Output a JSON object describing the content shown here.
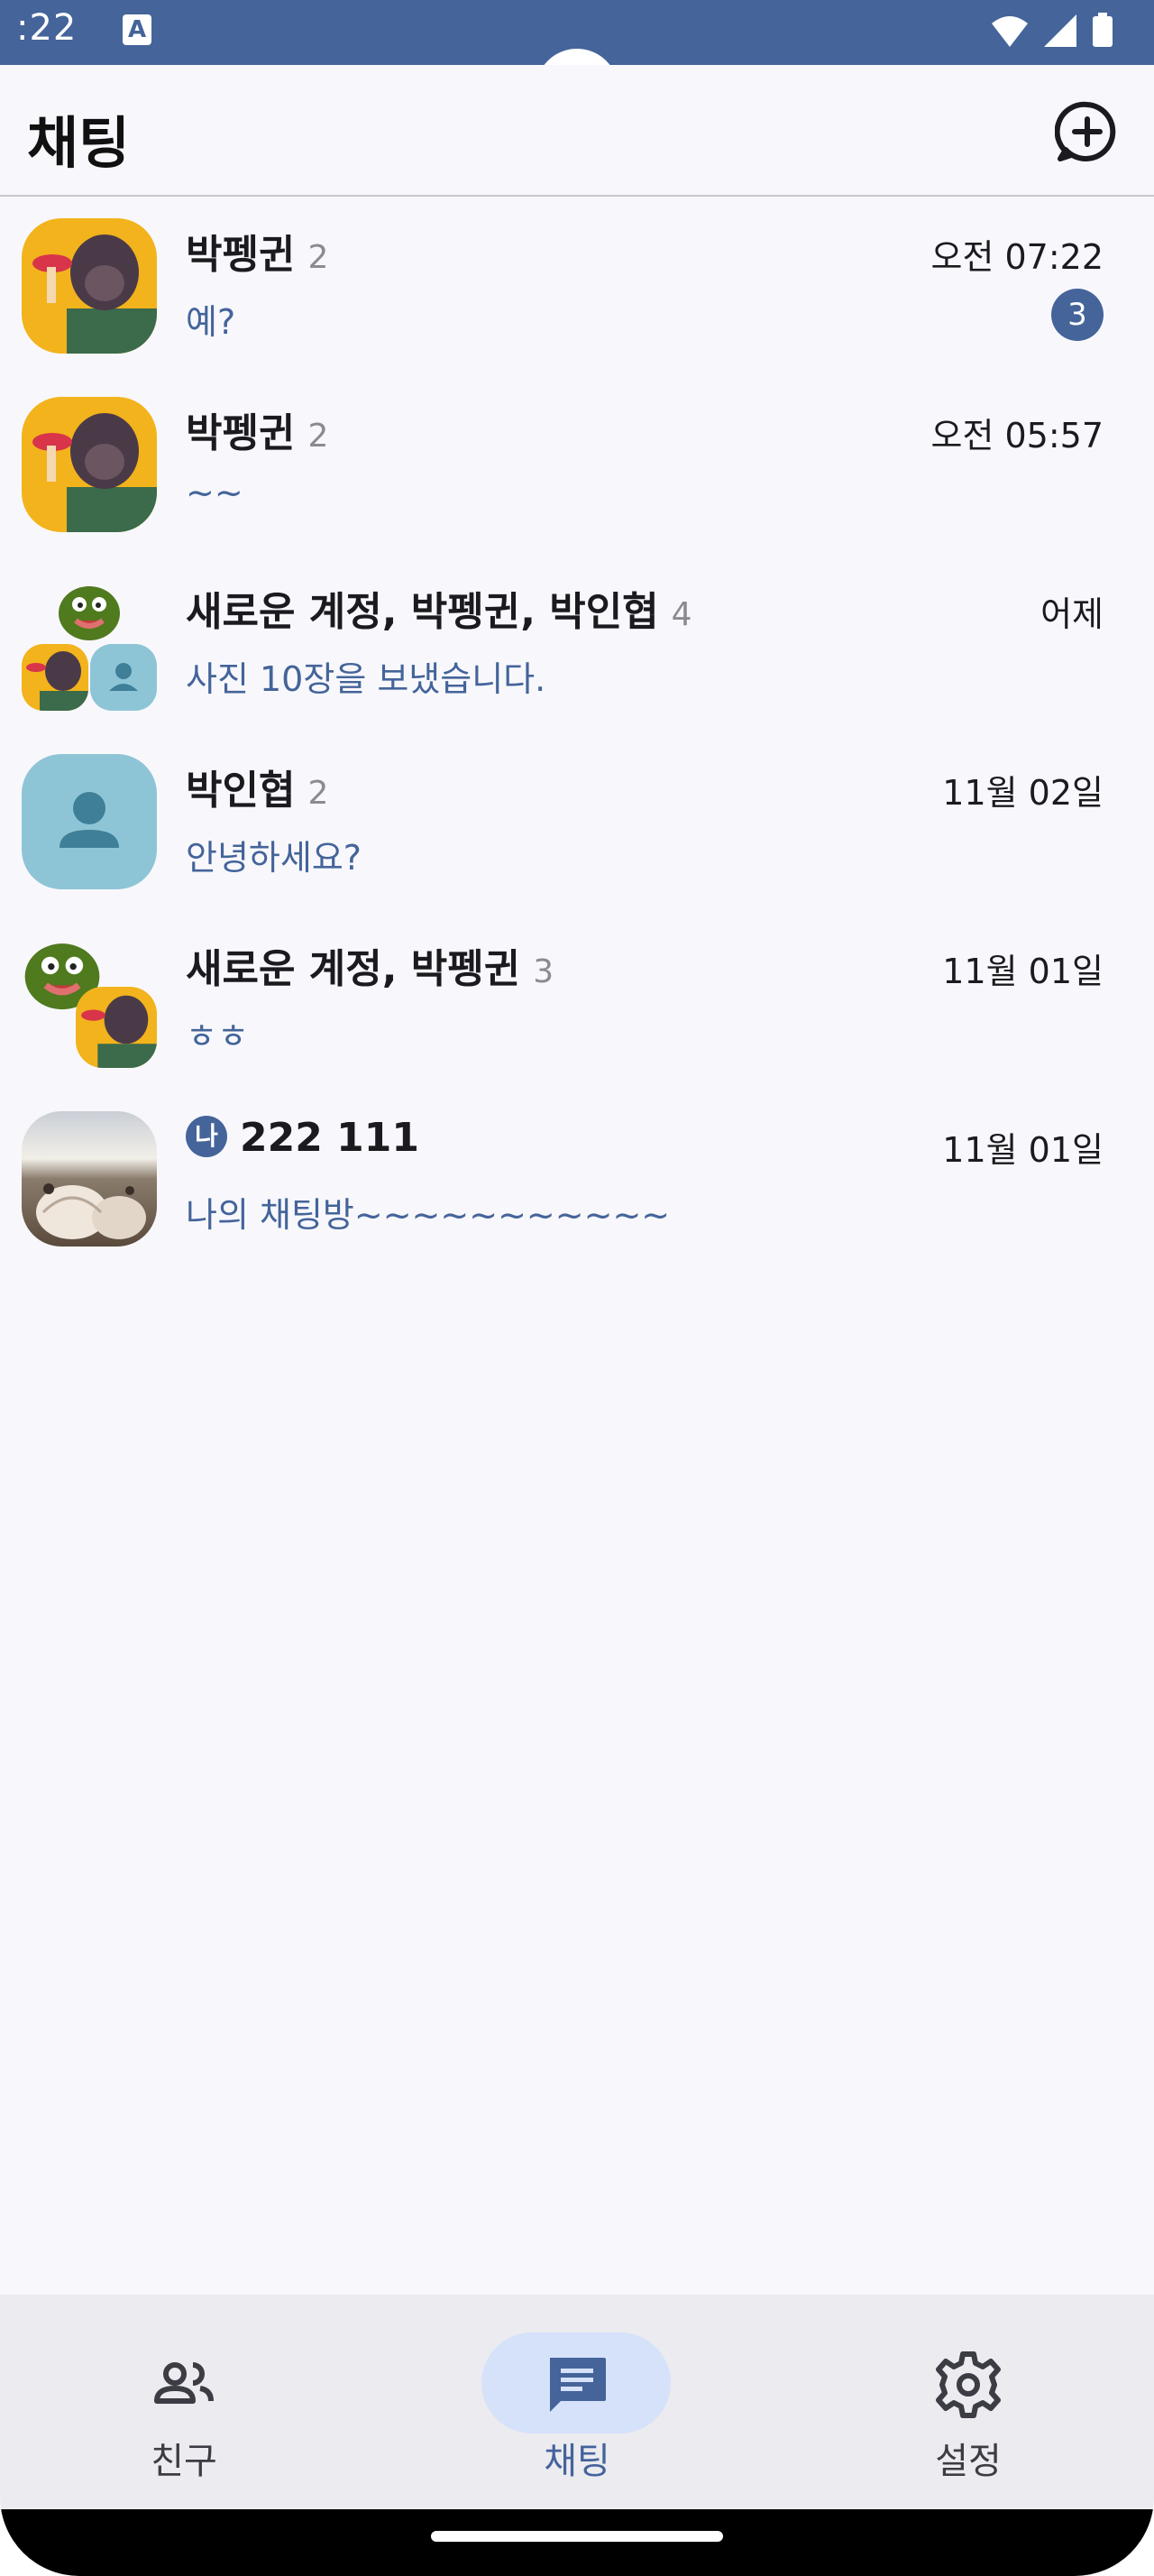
{
  "status_bar": {
    "time": ":22",
    "a_badge": "A"
  },
  "header": {
    "title": "채팅"
  },
  "chats": [
    {
      "name": "박펭귄",
      "count": "2",
      "time": "오전 07:22",
      "preview": "예?",
      "unread": "3"
    },
    {
      "name": "박펭귄",
      "count": "2",
      "time": "오전 05:57",
      "preview": "~~"
    },
    {
      "name": "새로운 계정, 박펭귄, 박인협",
      "count": "4",
      "time": "어제",
      "preview": "사진 10장을 보냈습니다."
    },
    {
      "name": "박인협",
      "count": "2",
      "time": "11월 02일",
      "preview": "안녕하세요?"
    },
    {
      "name": "새로운 계정, 박펭귄",
      "count": "3",
      "time": "11월 01일",
      "preview": "ㅎㅎ"
    },
    {
      "me_label": "나",
      "name": "222 111",
      "time": "11월 01일",
      "preview": "나의 채팅방~~~~~~~~~~~"
    }
  ],
  "nav": {
    "friends": "친구",
    "chats": "채팅",
    "settings": "설정"
  },
  "colors": {
    "accent": "#44649a",
    "preview_text": "#44649a",
    "nav_active_pill": "#d6e2fa",
    "placeholder_avatar": "#8ec5d6"
  },
  "icons": {
    "new_chat": "chat-plus-icon",
    "friends": "people-icon",
    "chats": "chat-bubble-icon",
    "settings": "gear-icon"
  }
}
